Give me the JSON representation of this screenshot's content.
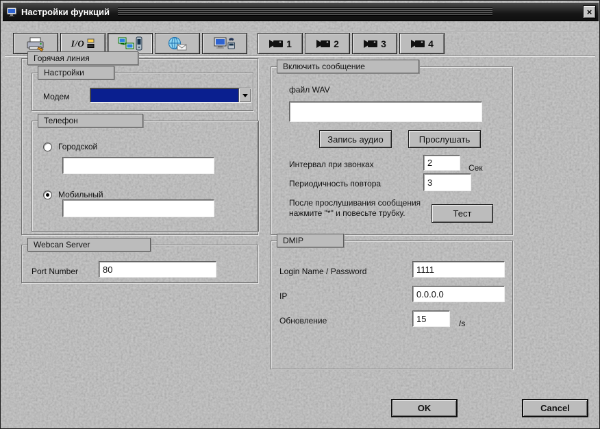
{
  "window": {
    "title": "Настройки функций",
    "close_label": "×"
  },
  "tabs": [
    {
      "icon": "printer-fax-icon"
    },
    {
      "icon": "io-ports-icon",
      "label": "I/O"
    },
    {
      "icon": "network-phone-icon"
    },
    {
      "icon": "globe-mail-icon"
    },
    {
      "icon": "remote-monitor-icon"
    },
    {
      "icon": "camera-icon",
      "label": "1"
    },
    {
      "icon": "camera-icon",
      "label": "2"
    },
    {
      "icon": "camera-icon",
      "label": "3"
    },
    {
      "icon": "camera-icon",
      "label": "4"
    }
  ],
  "hotline": {
    "title": "Горячая линия",
    "settings": {
      "title": "Настройки",
      "modem_label": "Модем",
      "modem_value": ""
    },
    "phone": {
      "title": "Телефон",
      "city_label": "Городской",
      "city_value": "",
      "mobile_label": "Мобильный",
      "mobile_value": ""
    }
  },
  "message": {
    "title": "Включить сообщение",
    "wav_label": "файл WAV",
    "wav_value": "",
    "record_button": "Запись аудио",
    "listen_button": "Прослушать",
    "interval_label": "Интервал при звонках",
    "interval_value": "2",
    "interval_unit": "Сек",
    "repeat_label": "Периодичность повтора",
    "repeat_value": "3",
    "note_line1": "После прослушивания сообщения",
    "note_line2": "нажмите  \"*\" и повесьте трубку.",
    "test_button": "Тест"
  },
  "webcam_server": {
    "title": "Webcan Server",
    "port_label": "Port Number",
    "port_value": "80"
  },
  "dmip": {
    "title": "DMIP",
    "login_label": "Login Name / Password",
    "login_value": "1111",
    "ip_label": "IP",
    "ip_value": "0.0.0.0",
    "update_label": "Обновление",
    "update_value": "15",
    "update_unit": "/s"
  },
  "footer": {
    "ok_button": "OK",
    "cancel_button": "Cancel"
  }
}
